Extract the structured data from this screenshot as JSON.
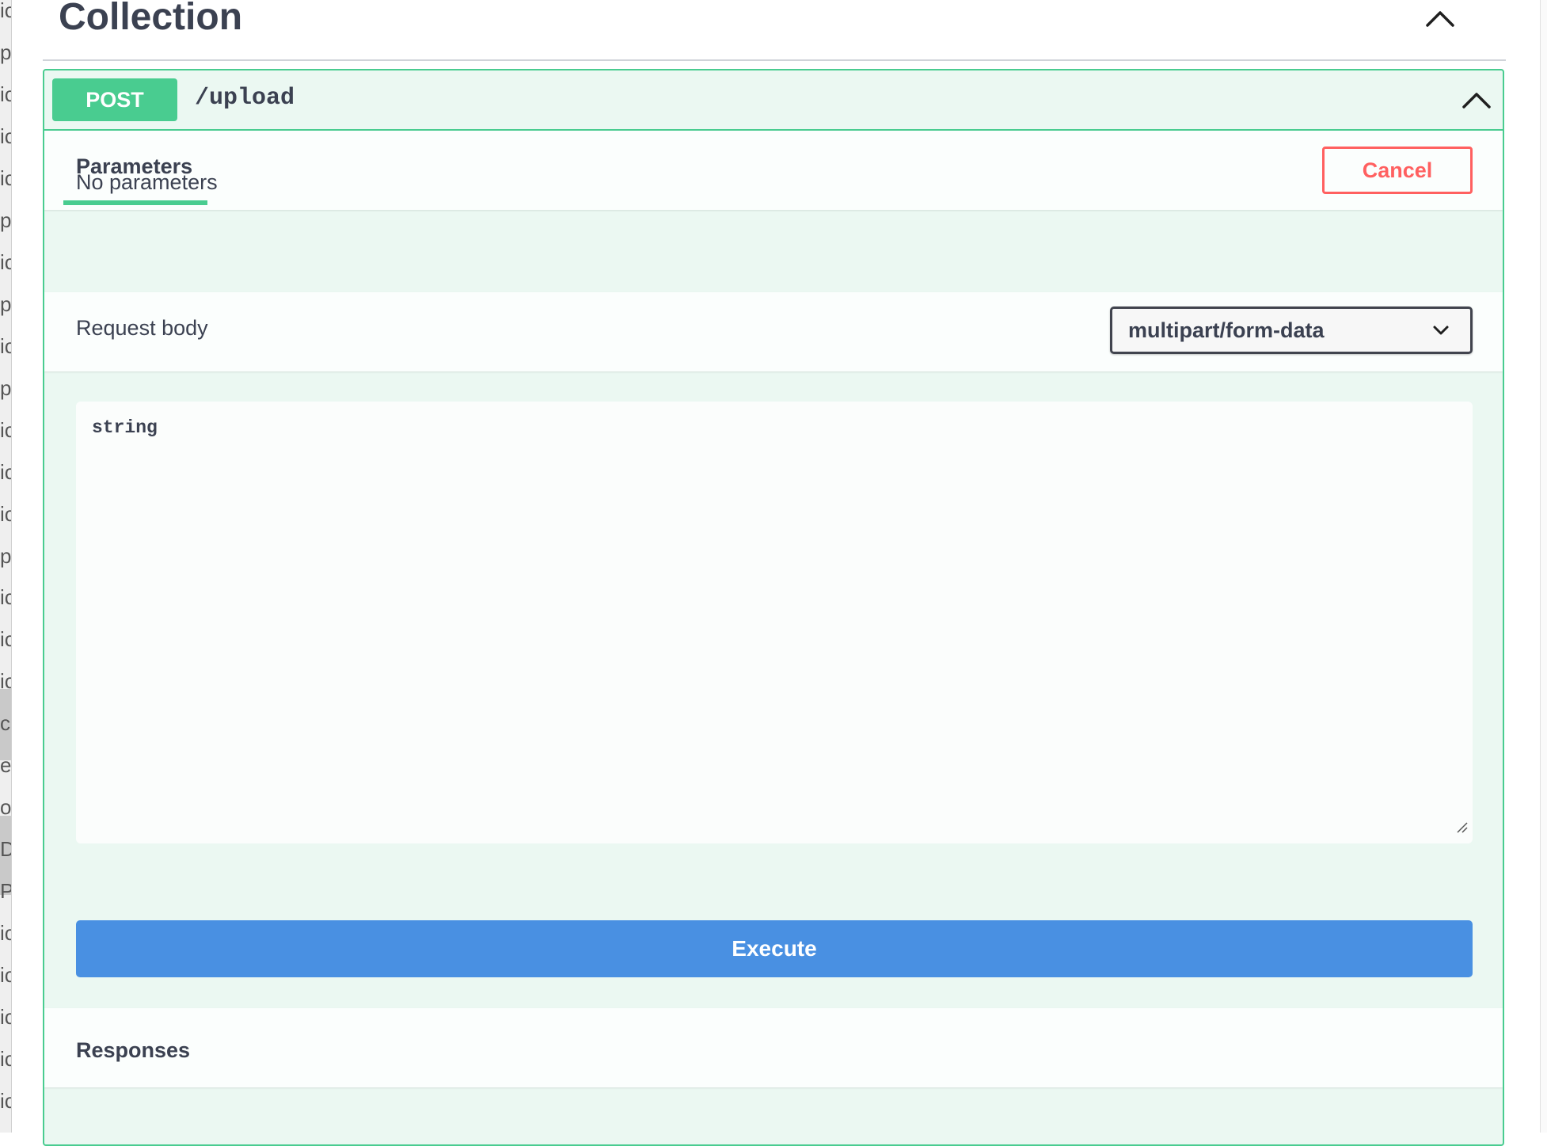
{
  "left_fragments": [
    "ic",
    "p",
    "ic",
    "ic",
    "ic",
    "p",
    "ic",
    "p",
    "ic",
    "p",
    "ic",
    "ic",
    "ic",
    "p",
    "ic",
    "ic",
    "ic",
    "c",
    "e",
    "o",
    "D",
    "P",
    "ic",
    "ic",
    "ic",
    "ic",
    "ic"
  ],
  "tag": {
    "title": "Collection",
    "collapse_icon": "chevron-up-icon"
  },
  "operation": {
    "method": "POST",
    "path": "/upload",
    "collapse_icon": "chevron-up-icon",
    "tabs": {
      "parameters_label": "Parameters"
    },
    "cancel_label": "Cancel",
    "no_parameters_text": "No parameters",
    "request_body": {
      "label": "Request body",
      "content_type": "multipart/form-data",
      "value": "string"
    },
    "execute_label": "Execute",
    "responses_label": "Responses"
  },
  "colors": {
    "post_green": "#49cc90",
    "post_bg": "#ebf8f2",
    "cancel_red": "#ff6060",
    "execute_blue": "#4990e2",
    "text": "#3b4151"
  }
}
